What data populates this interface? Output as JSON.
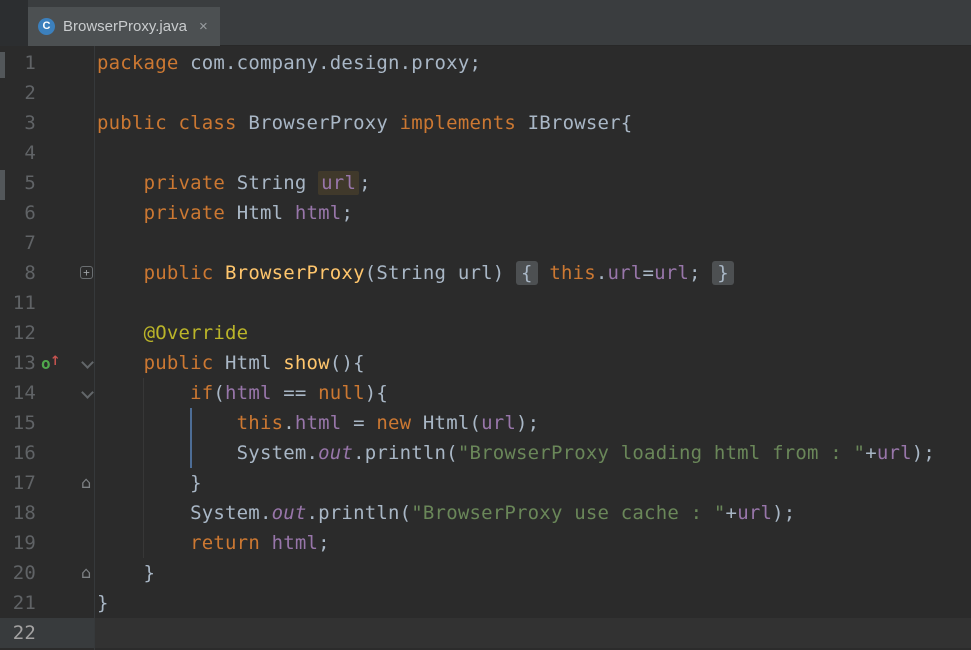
{
  "tab_bar": {
    "tabs": [
      {
        "title": "BrowserProxy.java",
        "icon": "java-class-icon",
        "icon_letter": "C",
        "close_label": "×",
        "active": true
      }
    ]
  },
  "editor": {
    "colors": {
      "background": "#2b2b2b",
      "keyword": "#cc7832",
      "default_text": "#a9b7c6",
      "field": "#9876aa",
      "method_declaration": "#ffc66d",
      "annotation": "#bbb529",
      "string": "#6a8759",
      "line_number": "#606366",
      "identifier_highlight_bg": "#40392b",
      "folded_region_bg": "#4d5052",
      "active_indent_guide": "#4d6d96"
    },
    "lines": [
      {
        "num": "1",
        "icons": [],
        "tokens": [
          [
            "kw",
            "package "
          ],
          [
            "def",
            "com.company.design.proxy;"
          ]
        ]
      },
      {
        "num": "2",
        "icons": [],
        "tokens": []
      },
      {
        "num": "3",
        "icons": [],
        "tokens": [
          [
            "kw",
            "public class "
          ],
          [
            "def",
            "BrowserProxy "
          ],
          [
            "kw",
            "implements "
          ],
          [
            "def",
            "IBrowser{"
          ]
        ]
      },
      {
        "num": "4",
        "icons": [],
        "tokens": []
      },
      {
        "num": "5",
        "icons": [],
        "tokens": [
          [
            "def",
            "    "
          ],
          [
            "kw",
            "private "
          ],
          [
            "def",
            "String "
          ],
          [
            "hl",
            "url"
          ],
          [
            "def",
            ";"
          ]
        ]
      },
      {
        "num": "6",
        "icons": [],
        "tokens": [
          [
            "def",
            "    "
          ],
          [
            "kw",
            "private "
          ],
          [
            "def",
            "Html "
          ],
          [
            "fld",
            "html"
          ],
          [
            "def",
            ";"
          ]
        ]
      },
      {
        "num": "7",
        "icons": [],
        "tokens": []
      },
      {
        "num": "8",
        "icons": [
          "fold-expand"
        ],
        "tokens": [
          [
            "def",
            "    "
          ],
          [
            "kw",
            "public "
          ],
          [
            "mth",
            "BrowserProxy"
          ],
          [
            "def",
            "(String url) "
          ],
          [
            "foldb",
            "{"
          ],
          [
            "def",
            " "
          ],
          [
            "kw",
            "this"
          ],
          [
            "def",
            "."
          ],
          [
            "fld",
            "url"
          ],
          [
            "def",
            "="
          ],
          [
            "fld",
            "url"
          ],
          [
            "def",
            "; "
          ],
          [
            "foldb",
            "}"
          ]
        ]
      },
      {
        "num": "11",
        "icons": [],
        "tokens": []
      },
      {
        "num": "12",
        "icons": [],
        "tokens": [
          [
            "def",
            "    "
          ],
          [
            "ann",
            "@Override"
          ]
        ]
      },
      {
        "num": "13",
        "icons": [
          "override",
          "fold-down"
        ],
        "tokens": [
          [
            "def",
            "    "
          ],
          [
            "kw",
            "public "
          ],
          [
            "def",
            "Html "
          ],
          [
            "mth",
            "show"
          ],
          [
            "def",
            "(){"
          ]
        ]
      },
      {
        "num": "14",
        "icons": [
          "fold-down"
        ],
        "tokens": [
          [
            "def",
            "        "
          ],
          [
            "kw",
            "if"
          ],
          [
            "def",
            "("
          ],
          [
            "fld",
            "html"
          ],
          [
            "def",
            " == "
          ],
          [
            "kw",
            "null"
          ],
          [
            "def",
            "){"
          ]
        ]
      },
      {
        "num": "15",
        "icons": [],
        "tokens": [
          [
            "def",
            "            "
          ],
          [
            "kw",
            "this"
          ],
          [
            "def",
            "."
          ],
          [
            "fld",
            "html"
          ],
          [
            "def",
            " = "
          ],
          [
            "kw",
            "new"
          ],
          [
            "def",
            " Html("
          ],
          [
            "fld",
            "url"
          ],
          [
            "def",
            ");"
          ]
        ]
      },
      {
        "num": "16",
        "icons": [],
        "tokens": [
          [
            "def",
            "            System."
          ],
          [
            "fldi",
            "out"
          ],
          [
            "def",
            ".println("
          ],
          [
            "str",
            "\"BrowserProxy loading html from : \""
          ],
          [
            "def",
            "+"
          ],
          [
            "fld",
            "url"
          ],
          [
            "def",
            ");"
          ]
        ]
      },
      {
        "num": "17",
        "icons": [
          "fold-up"
        ],
        "tokens": [
          [
            "def",
            "        }"
          ]
        ]
      },
      {
        "num": "18",
        "icons": [],
        "tokens": [
          [
            "def",
            "        System."
          ],
          [
            "fldi",
            "out"
          ],
          [
            "def",
            ".println("
          ],
          [
            "str",
            "\"BrowserProxy use cache : \""
          ],
          [
            "def",
            "+"
          ],
          [
            "fld",
            "url"
          ],
          [
            "def",
            ");"
          ]
        ]
      },
      {
        "num": "19",
        "icons": [],
        "tokens": [
          [
            "def",
            "        "
          ],
          [
            "kw",
            "return "
          ],
          [
            "fld",
            "html"
          ],
          [
            "def",
            ";"
          ]
        ]
      },
      {
        "num": "20",
        "icons": [
          "fold-up"
        ],
        "tokens": [
          [
            "def",
            "    }"
          ]
        ]
      },
      {
        "num": "21",
        "icons": [],
        "tokens": [
          [
            "def",
            "}"
          ]
        ]
      },
      {
        "num": "22",
        "icons": [],
        "current": true,
        "tokens": []
      }
    ]
  }
}
